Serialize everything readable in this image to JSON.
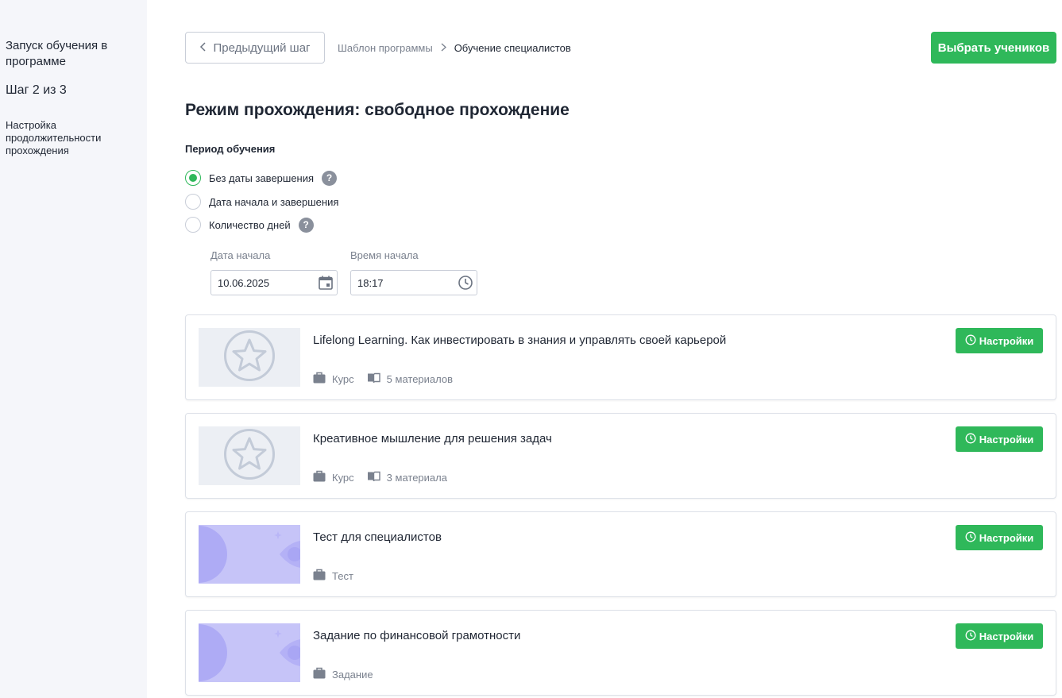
{
  "sidebar": {
    "title": "Запуск обучения в программе",
    "step": "Шаг 2 из 3",
    "description": "Настройка продолжительности прохождения"
  },
  "header": {
    "prev_label": "Предыдущий шаг",
    "breadcrumb": {
      "parent": "Шаблон программы",
      "current": "Обучение специалистов"
    },
    "primary_label": "Выбрать учеников"
  },
  "mode_title": "Режим прохождения: свободное прохождение",
  "period": {
    "label": "Период обучения",
    "options": [
      {
        "label": "Без даты завершения",
        "checked": true,
        "help": true
      },
      {
        "label": "Дата начала и завершения",
        "checked": false,
        "help": false
      },
      {
        "label": "Количество дней",
        "checked": false,
        "help": true
      }
    ],
    "help_glyph": "?"
  },
  "start": {
    "date_label": "Дата начала",
    "date_value": "10.06.2025",
    "time_label": "Время начала",
    "time_value": "18:17"
  },
  "items": [
    {
      "title": "Lifelong Learning. Как инвестировать в знания и управлять своей карьерой",
      "type": "Курс",
      "materials": "5 материалов",
      "thumb": "star"
    },
    {
      "title": "Креативное мышление для решения задач",
      "type": "Курс",
      "materials": "3 материала",
      "thumb": "star"
    },
    {
      "title": "Тест для специалистов",
      "type": "Тест",
      "materials": "",
      "thumb": "purple"
    },
    {
      "title": "Задание по финансовой грамотности",
      "type": "Задание",
      "materials": "",
      "thumb": "purple"
    }
  ],
  "settings_label": "Настройки",
  "colors": {
    "accent": "#2fb85a",
    "sidebar_bg": "#f5f6fa",
    "thumb_gray": "#eceff4",
    "thumb_purple": "#c6c4f8"
  },
  "icons": {
    "calendar": "calendar-icon",
    "clock": "clock-icon",
    "briefcase": "briefcase-icon",
    "book": "book-icon",
    "star": "star-icon"
  }
}
